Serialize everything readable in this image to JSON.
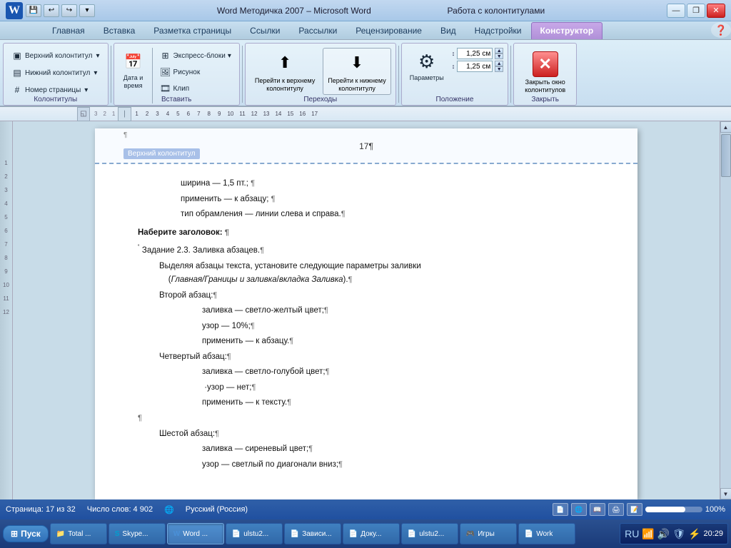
{
  "titlebar": {
    "title": "Word Методичка 2007 – Microsoft Word",
    "right_title": "Работа с колонтитулами",
    "minimize": "—",
    "restore": "❐",
    "close": "✕"
  },
  "ribbon": {
    "tabs": [
      "Главная",
      "Вставка",
      "Разметка страницы",
      "Ссылки",
      "Рассылки",
      "Рецензирование",
      "Вид",
      "Надстройки",
      "Конструктор"
    ],
    "active_tab": "Конструктор",
    "groups": {
      "kolontituly": {
        "label": "Колонтитулы",
        "items": [
          "Верхний колонтитул",
          "Нижний колонтитул",
          "Номер страницы"
        ]
      },
      "vstavit": {
        "label": "Вставить",
        "items": [
          "Экспресс-блоки",
          "Рисунок",
          "Клип"
        ],
        "date_label": "Дата и\nвремя"
      },
      "perekhody": {
        "label": "Переходы",
        "btn1": "Перейти к верхнему\nколонтитулу",
        "btn2": "Перейти к нижнему\nколонтитулу"
      },
      "parametry": {
        "label": "Положение",
        "param_label": "Параметры",
        "margin1_label": "1,25 см",
        "margin2_label": "1,25 см"
      },
      "zakryt": {
        "label": "Закрыть",
        "btn": "Закрыть окно\nколонтитулов"
      }
    }
  },
  "ruler": {
    "marks": [
      "3",
      "2",
      "1",
      "1",
      "2",
      "3",
      "4",
      "5",
      "6",
      "7",
      "8",
      "9",
      "10",
      "11",
      "12",
      "13",
      "14",
      "15",
      "16",
      "17"
    ]
  },
  "document": {
    "page_number": "17¶",
    "header_label": "Верхний колонтитул",
    "content": [
      {
        "indent": 1,
        "text": "ширина — 1,5 пт.;¶"
      },
      {
        "indent": 1,
        "text": "применить — к абзацу;¶"
      },
      {
        "indent": 1,
        "text": "тип обрамления — линии слева и справа.¶"
      },
      {
        "indent": 0,
        "bold": true,
        "text": "Наберите заголовок:¶"
      },
      {
        "indent": 0,
        "text": "˚ Задание 2.3. Заливка абзацев.¶"
      },
      {
        "indent": 1,
        "text": "Выделяя абзацы текста, установите следующие параметры заливки (Главная/Границы и заливка/вкладка Заливка).¶"
      },
      {
        "indent": 1,
        "text": "Второй абзац:¶"
      },
      {
        "indent": 2,
        "text": "заливка — светло-желтый цвет;¶"
      },
      {
        "indent": 2,
        "text": "узор — 10%;¶"
      },
      {
        "indent": 2,
        "text": "применить — к абзацу.¶"
      },
      {
        "indent": 1,
        "text": "Четвертый абзац:¶"
      },
      {
        "indent": 2,
        "text": "заливка — светло-голубой цвет;¶"
      },
      {
        "indent": 2,
        "text": "·узор — нет;¶"
      },
      {
        "indent": 2,
        "text": "применить — к тексту.¶"
      },
      {
        "indent": 0,
        "text": "¶"
      },
      {
        "indent": 1,
        "text": "Шестой абзац:¶"
      },
      {
        "indent": 2,
        "text": "заливка — сиреневый цвет;¶"
      },
      {
        "indent": 2,
        "text": "узор — светлый по диагонали вниз;¶"
      }
    ]
  },
  "statusbar": {
    "page_info": "Страница: 17 из 32",
    "word_count": "Число слов: 4 902",
    "language": "Русский (Россия)",
    "zoom": "100%"
  },
  "taskbar": {
    "start_label": "Пуск",
    "items": [
      {
        "label": "Total ...",
        "icon": "📁"
      },
      {
        "label": "Skype...",
        "icon": "S"
      },
      {
        "label": "Word ...",
        "icon": "W",
        "active": true
      },
      {
        "label": "ulstu2...",
        "icon": "📄"
      },
      {
        "label": "Зависи...",
        "icon": "📄"
      },
      {
        "label": "Доку...",
        "icon": "📄"
      },
      {
        "label": "ulstu2...",
        "icon": "📄"
      },
      {
        "label": "Игры",
        "icon": "🎮"
      },
      {
        "label": "Work",
        "icon": "📄"
      }
    ],
    "lang": "RU",
    "time": "20:29"
  }
}
